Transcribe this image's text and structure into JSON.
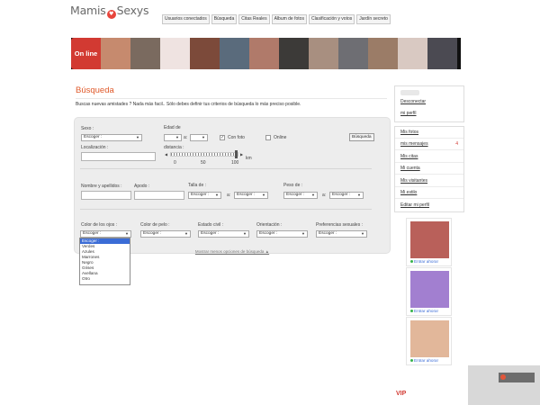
{
  "header": {
    "logo_left": "Mamis",
    "logo_right": "Sexys",
    "nav": [
      "Usuarios conectados",
      "Búsqueda",
      "Citas Reales",
      "Album de fotos",
      "Clasificación y votos",
      "Jardín secreto"
    ]
  },
  "banner": {
    "online_label": "On line"
  },
  "page": {
    "title": "Búsqueda",
    "intro": "Buscas nuevas amistades ? Nada más facil.. Sólo debes definir tus criterios de búsqueda lo más preciso posible."
  },
  "form": {
    "sexo_label": "Sexo :",
    "sexo_value": "Escoger :",
    "edad_label": "Edad de",
    "edad_a": "a:",
    "con_foto": "Con foto",
    "online": "Online",
    "busqueda_btn": "Búsqueda",
    "localizacion_label": "Localización :",
    "distancia_label": "distancia :",
    "slider_ticks": [
      "0",
      "50",
      "100"
    ],
    "slider_unit": "km",
    "nombre_label": "Nombre y apellidos :",
    "apodo_label": "Apodo :",
    "talla_label": "Talla de :",
    "talla_from": "Escoger :",
    "talla_a": "a:",
    "talla_to": "Escoger :",
    "peso_label": "Peso de :",
    "peso_from": "Escoger :",
    "peso_a": "a:",
    "peso_to": "Escoger :",
    "ojos_label": "Color de los ojos :",
    "ojos_value": "Escoger :",
    "pelo_label": "Color de pelo :",
    "pelo_value": "Escoger :",
    "civil_label": "Estado civil :",
    "civil_value": "Escoger :",
    "orient_label": "Orientación :",
    "orient_value": "Escoger :",
    "pref_label": "Preferencias sexuales :",
    "pref_value": "Escoger :",
    "eye_options": [
      "Escoger :",
      "Verdes",
      "Azules",
      "Marrones",
      "Negro",
      "Grises",
      "Avellana",
      "Otro"
    ],
    "less_options": "Mostrar menos opciones de búsqueda ▲"
  },
  "sidebar": {
    "desconectar": "Desconectar",
    "mi_perfil": "mi perfil",
    "menu": [
      "Mis fotos",
      "mis mensajes",
      "Mis citas",
      "Mi cuenta",
      "Mis visitantes",
      "Mi estilo",
      "Editar mi perfil"
    ],
    "messages_count": "4",
    "enter_label": "Entrar ahora!",
    "vip": "VIP"
  },
  "colors": {
    "accent": "#e05a2b",
    "online_red": "#d23a32",
    "link_blue": "#3b6cd6",
    "status_green": "#36b24a"
  }
}
